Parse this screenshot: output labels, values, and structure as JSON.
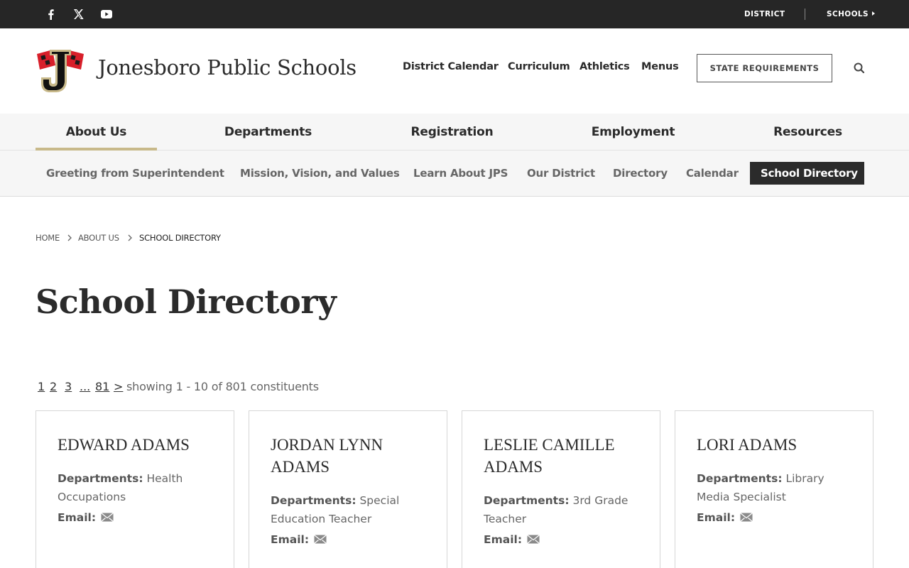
{
  "topbar": {
    "social": [
      "facebook-icon",
      "x-icon",
      "youtube-icon"
    ],
    "district_label": "DISTRICT",
    "schools_label": "SCHOOLS"
  },
  "header": {
    "site_name": "Jonesboro Public Schools",
    "quick_links": [
      "District Calendar",
      "Curriculum",
      "Athletics",
      "Menus"
    ],
    "state_requirements_label": "STATE REQUIREMENTS"
  },
  "main_nav": {
    "items": [
      "About Us",
      "Departments",
      "Registration",
      "Employment",
      "Resources"
    ],
    "active": "About Us"
  },
  "sub_nav": {
    "items": [
      "Greeting from Superintendent",
      "Mission, Vision, and Values",
      "Learn About JPS",
      "Our District",
      "Directory",
      "Calendar",
      "School Directory"
    ],
    "active": "School Directory"
  },
  "breadcrumb": [
    "HOME",
    "ABOUT US",
    "SCHOOL DIRECTORY"
  ],
  "page_title": "School Directory",
  "pagination": {
    "pages": [
      "1",
      "2",
      "3",
      "...",
      "81",
      ">"
    ],
    "summary": "showing 1 - 10 of 801 constituents"
  },
  "directory": {
    "dept_label": "Departments:",
    "email_label": "Email:",
    "cards": [
      {
        "name": "EDWARD ADAMS",
        "department": "Health Occupations"
      },
      {
        "name": "JORDAN LYNN ADAMS",
        "department": "Special Education Teacher"
      },
      {
        "name": "LESLIE CAMILLE ADAMS",
        "department": "3rd Grade Teacher"
      },
      {
        "name": "LORI ADAMS",
        "department": "Library Media Specialist"
      }
    ]
  },
  "colors": {
    "topbar": "#262626",
    "accent_underline": "#c8b98a",
    "logo_red": "#d81f2a",
    "active_subnav": "#2b2b2b"
  }
}
